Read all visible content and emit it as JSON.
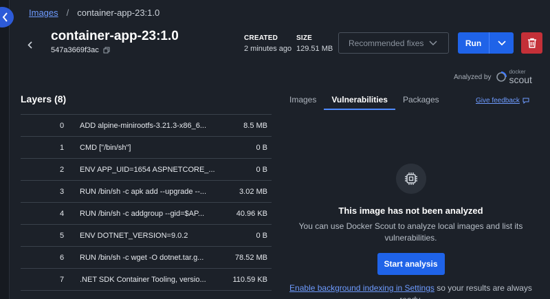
{
  "breadcrumb": {
    "root": "Images",
    "separator": "/",
    "current": "container-app-23:1.0"
  },
  "header": {
    "title": "container-app-23:1.0",
    "sha": "547a3669f3ac",
    "created_label": "CREATED",
    "created_value": "2 minutes ago",
    "size_label": "SIZE",
    "size_value": "129.51 MB",
    "recommended_fixes": "Recommended fixes",
    "run": "Run"
  },
  "analyzed": {
    "by": "Analyzed by",
    "brand_small": "docker",
    "brand_big": "scout"
  },
  "layers": {
    "title": "Layers (8)",
    "rows": [
      {
        "idx": "0",
        "cmd": "ADD alpine-minirootfs-3.21.3-x86_6...",
        "size": "8.5 MB"
      },
      {
        "idx": "1",
        "cmd": "CMD [\"/bin/sh\"]",
        "size": "0 B"
      },
      {
        "idx": "2",
        "cmd": "ENV APP_UID=1654 ASPNETCORE_...",
        "size": "0 B"
      },
      {
        "idx": "3",
        "cmd": "RUN /bin/sh -c apk add --upgrade --...",
        "size": "3.02 MB"
      },
      {
        "idx": "4",
        "cmd": "RUN /bin/sh -c addgroup --gid=$AP...",
        "size": "40.96 KB"
      },
      {
        "idx": "5",
        "cmd": "ENV DOTNET_VERSION=9.0.2",
        "size": "0 B"
      },
      {
        "idx": "6",
        "cmd": "RUN /bin/sh -c wget -O dotnet.tar.g...",
        "size": "78.52 MB"
      },
      {
        "idx": "7",
        "cmd": ".NET SDK Container Tooling, versio...",
        "size": "110.59 KB"
      }
    ]
  },
  "tabs": {
    "images": "Images",
    "vulnerabilities": "Vulnerabilities",
    "packages": "Packages"
  },
  "feedback": "Give feedback",
  "empty_state": {
    "title": "This image has not been analyzed",
    "description": "You can use Docker Scout to analyze local images and list its vulnerabilities.",
    "start": "Start analysis",
    "index_link": "Enable background indexing in Settings",
    "index_rest": " so your results are always ready."
  },
  "colors": {
    "accent": "#1f63e8",
    "link": "#6e9bff",
    "danger": "#c43038",
    "background": "#1c2129"
  }
}
